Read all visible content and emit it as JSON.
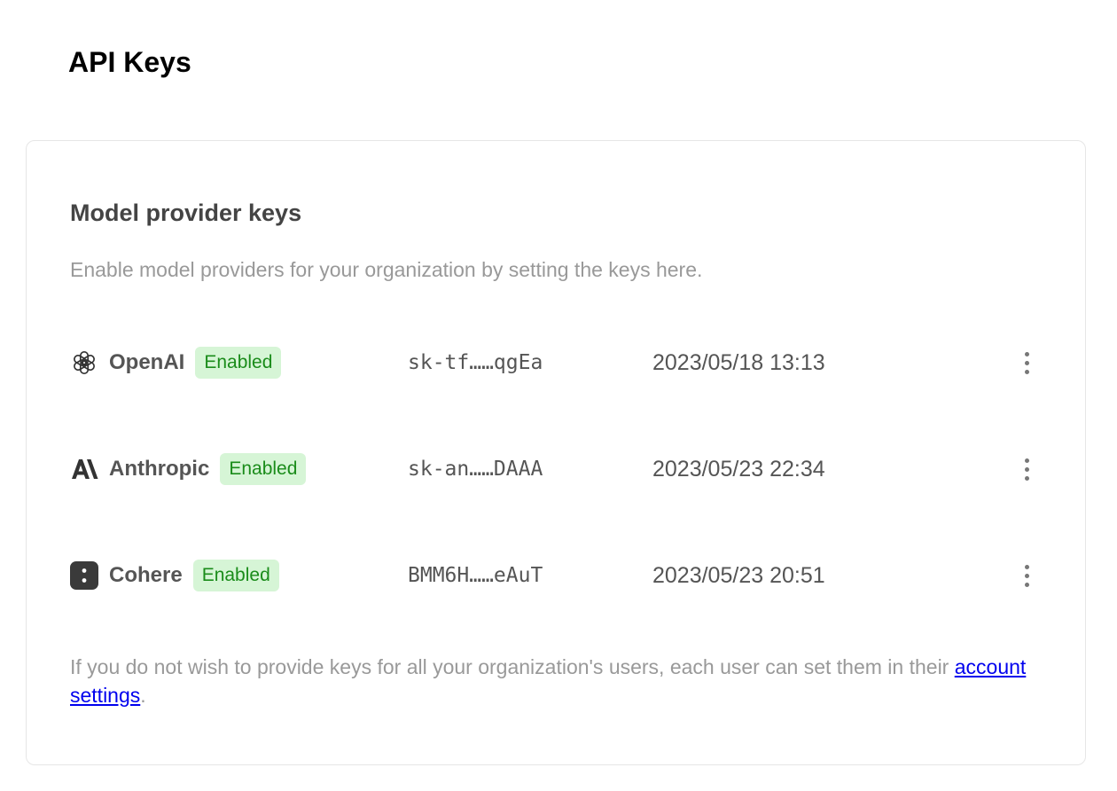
{
  "page": {
    "title": "API Keys"
  },
  "section": {
    "title": "Model provider keys",
    "description": "Enable model providers for your organization by setting the keys here."
  },
  "providers": [
    {
      "name": "OpenAI",
      "icon": "openai-logo-icon",
      "status": "Enabled",
      "key": "sk-tf……qgEa",
      "timestamp": "2023/05/18 13:13"
    },
    {
      "name": "Anthropic",
      "icon": "anthropic-logo-icon",
      "status": "Enabled",
      "key": "sk-an……DAAA",
      "timestamp": "2023/05/23 22:34"
    },
    {
      "name": "Cohere",
      "icon": "cohere-logo-icon",
      "status": "Enabled",
      "key": "BMM6H……eAuT",
      "timestamp": "2023/05/23 20:51"
    }
  ],
  "footer": {
    "text_before": "If you do not wish to provide keys for all your organization's users, each user can set them in their ",
    "link_text": "account settings",
    "text_after": "."
  },
  "colors": {
    "badge_bg": "#d6f5d6",
    "badge_text": "#1a8c1a",
    "link": "#0000ee"
  }
}
